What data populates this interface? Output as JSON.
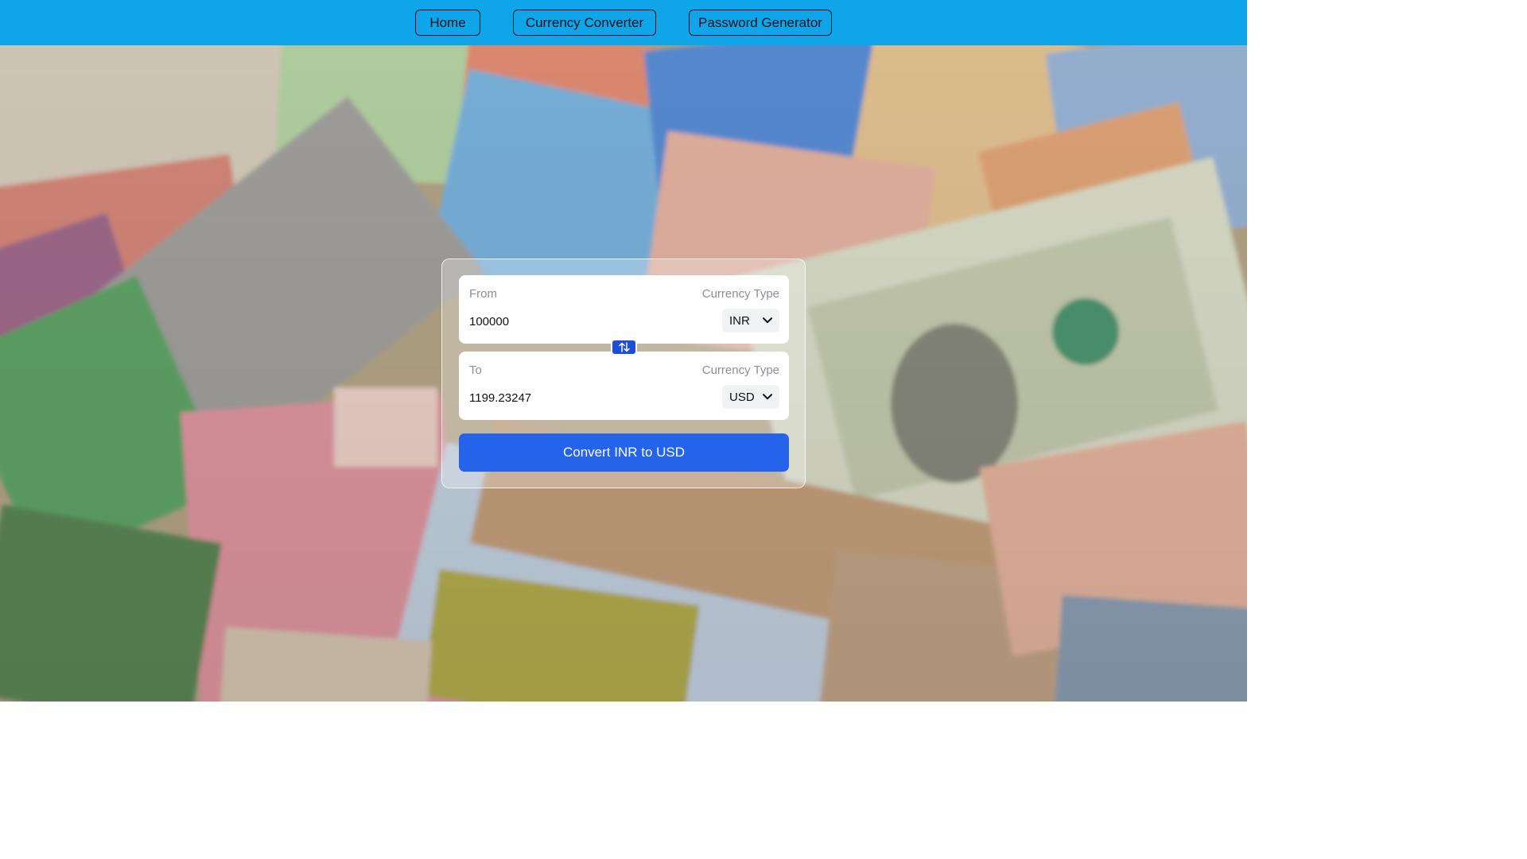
{
  "nav": {
    "home_label": "Home",
    "currency_label": "Currency Converter",
    "password_label": "Password Generator"
  },
  "converter": {
    "from": {
      "label": "From",
      "type_label": "Currency Type",
      "amount": "100000",
      "currency": "INR"
    },
    "to": {
      "label": "To",
      "type_label": "Currency Type",
      "amount": "1199.23247",
      "currency": "USD"
    },
    "swap_icon": "swap-vertical-icon",
    "convert_label": "Convert INR to USD"
  },
  "colors": {
    "topbar": "#0ea5e9",
    "swap_button": "#1d4ed8",
    "convert_button": "#2563eb"
  }
}
